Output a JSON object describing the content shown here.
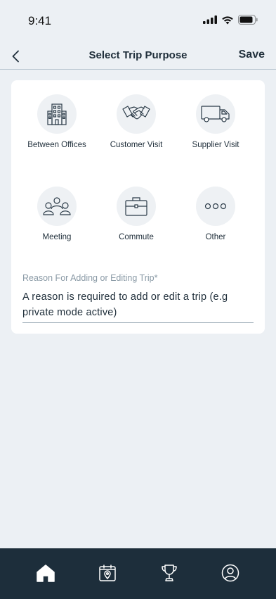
{
  "status_bar": {
    "time": "9:41"
  },
  "nav": {
    "title": "Select Trip Purpose",
    "save_label": "Save",
    "back_icon": "chevron-left-icon"
  },
  "purposes": [
    {
      "label": "Between Offices",
      "icon": "building-icon"
    },
    {
      "label": "Customer Visit",
      "icon": "handshake-icon"
    },
    {
      "label": "Supplier Visit",
      "icon": "truck-icon"
    },
    {
      "label": "Meeting",
      "icon": "people-icon"
    },
    {
      "label": "Commute",
      "icon": "briefcase-icon"
    },
    {
      "label": "Other",
      "icon": "more-icon"
    }
  ],
  "reason": {
    "label": "Reason For Adding or Editing Trip*",
    "value": "A reason is required to add or edit a trip (e.g private mode active)"
  },
  "tab_bar": {
    "tabs": [
      {
        "icon": "home-icon",
        "active": true
      },
      {
        "icon": "calendar-location-icon",
        "active": false
      },
      {
        "icon": "trophy-icon",
        "active": false
      },
      {
        "icon": "profile-icon",
        "active": false
      }
    ]
  },
  "colors": {
    "background": "#ecf0f4",
    "card": "#ffffff",
    "text": "#1f2e3a",
    "muted": "#8a9aa6",
    "tab_bar": "#1d2e3b",
    "icon_circle": "#eef1f4"
  }
}
